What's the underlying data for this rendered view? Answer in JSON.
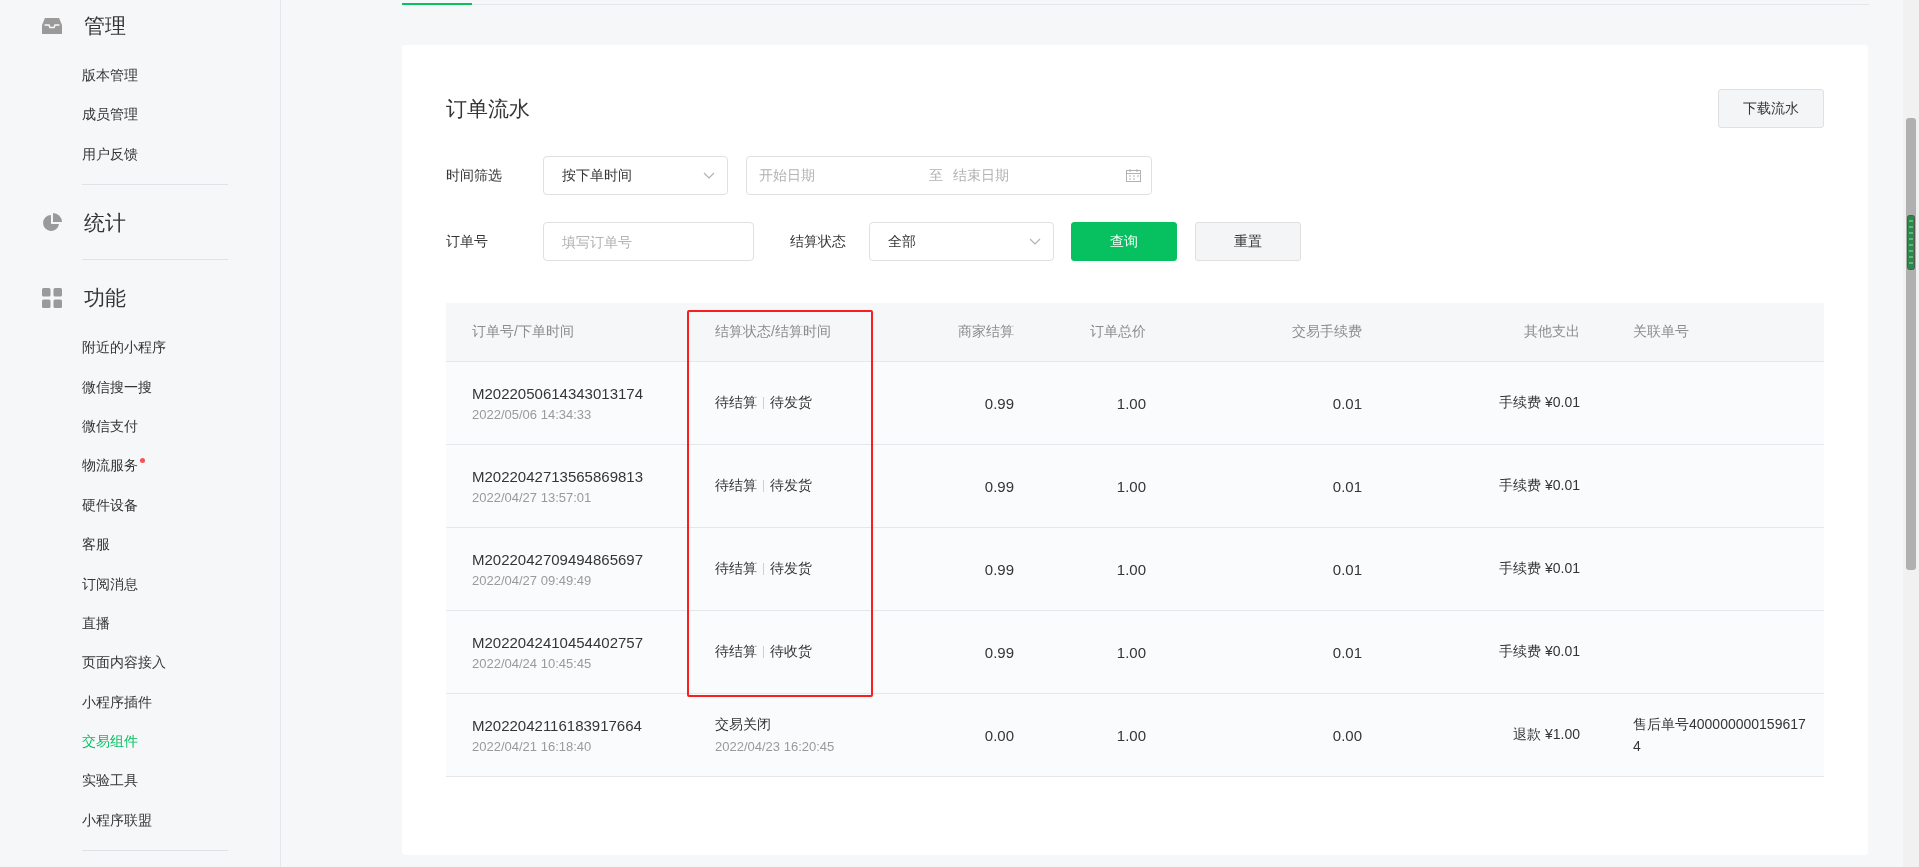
{
  "sidebar": {
    "sections": [
      {
        "title": "管理",
        "items": [
          {
            "label": "版本管理",
            "selected": false,
            "badge": false
          },
          {
            "label": "成员管理",
            "selected": false,
            "badge": false
          },
          {
            "label": "用户反馈",
            "selected": false,
            "badge": false
          }
        ]
      },
      {
        "title": "统计"
      },
      {
        "title": "功能",
        "items": [
          {
            "label": "附近的小程序",
            "selected": false,
            "badge": false
          },
          {
            "label": "微信搜一搜",
            "selected": false,
            "badge": false
          },
          {
            "label": "微信支付",
            "selected": false,
            "badge": false
          },
          {
            "label": "物流服务",
            "selected": false,
            "badge": true
          },
          {
            "label": "硬件设备",
            "selected": false,
            "badge": false
          },
          {
            "label": "客服",
            "selected": false,
            "badge": false
          },
          {
            "label": "订阅消息",
            "selected": false,
            "badge": false
          },
          {
            "label": "直播",
            "selected": false,
            "badge": false
          },
          {
            "label": "页面内容接入",
            "selected": false,
            "badge": false
          },
          {
            "label": "小程序插件",
            "selected": false,
            "badge": false
          },
          {
            "label": "交易组件",
            "selected": true,
            "badge": false
          },
          {
            "label": "实验工具",
            "selected": false,
            "badge": false
          },
          {
            "label": "小程序联盟",
            "selected": false,
            "badge": false
          }
        ]
      }
    ]
  },
  "card": {
    "title": "订单流水",
    "download_button": "下载流水",
    "filters": {
      "time_label": "时间筛选",
      "time_select": "按下单时间",
      "start_placeholder": "开始日期",
      "range_separator": "至",
      "end_placeholder": "结束日期",
      "order_label": "订单号",
      "order_placeholder": "填写订单号",
      "status_label": "结算状态",
      "status_select": "全部",
      "query_button": "查询",
      "reset_button": "重置"
    },
    "table": {
      "columns": [
        {
          "label": "订单号/下单时间",
          "highlighted": false
        },
        {
          "label": "结算状态/结算时间",
          "highlighted": true
        },
        {
          "label": "商家结算",
          "highlighted": false
        },
        {
          "label": "订单总价",
          "highlighted": false
        },
        {
          "label": "交易手续费",
          "highlighted": false
        },
        {
          "label": "其他支出",
          "highlighted": false
        },
        {
          "label": "关联单号",
          "highlighted": false
        }
      ],
      "rows": [
        {
          "order_no": "M2022050614343013174",
          "order_time": "2022/05/06 14:34:33",
          "settlement_status": "待结算",
          "shipping_status": "待发货",
          "merchant_settlement": "0.99",
          "total": "1.00",
          "fee": "0.01",
          "other": "手续费 ¥0.01",
          "highlighted": true
        },
        {
          "order_no": "M2022042713565869813",
          "order_time": "2022/04/27 13:57:01",
          "settlement_status": "待结算",
          "shipping_status": "待发货",
          "merchant_settlement": "0.99",
          "total": "1.00",
          "fee": "0.01",
          "other": "手续费 ¥0.01",
          "highlighted": true
        },
        {
          "order_no": "M2022042709494865697",
          "order_time": "2022/04/27 09:49:49",
          "settlement_status": "待结算",
          "shipping_status": "待发货",
          "merchant_settlement": "0.99",
          "total": "1.00",
          "fee": "0.01",
          "other": "手续费 ¥0.01",
          "highlighted": true
        },
        {
          "order_no": "M2022042410454402757",
          "order_time": "2022/04/24 10:45:45",
          "settlement_status": "待结算",
          "shipping_status": "待收货",
          "merchant_settlement": "0.99",
          "total": "1.00",
          "fee": "0.01",
          "other": "手续费 ¥0.01",
          "highlighted": true
        },
        {
          "order_no": "M2022042116183917664",
          "order_time": "2022/04/21 16:18:40",
          "settlement_status": "交易关闭",
          "settlement_time": "2022/04/23 16:20:45",
          "merchant_settlement": "0.00",
          "total": "1.00",
          "fee": "0.00",
          "other": "退款 ¥1.00",
          "related": "售后单号4000000001596174",
          "highlighted": false
        }
      ]
    }
  }
}
